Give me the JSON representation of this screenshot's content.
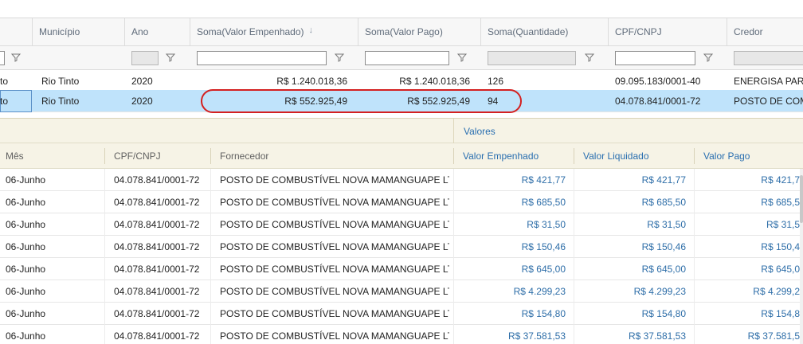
{
  "main_grid": {
    "columns": [
      {
        "label": "Município"
      },
      {
        "label": "Ano"
      },
      {
        "label": "Soma(Valor Empenhado)",
        "sort_icon": "arrow-down"
      },
      {
        "label": "Soma(Valor Pago)"
      },
      {
        "label": "Soma(Quantidade)"
      },
      {
        "label": "CPF/CNPJ"
      },
      {
        "label": "Credor"
      }
    ],
    "rows": [
      {
        "first": "to",
        "municipio": "Rio Tinto",
        "ano": "2020",
        "empenhado": "R$ 1.240.018,36",
        "pago": "R$ 1.240.018,36",
        "quantidade": "126",
        "cpf": "09.095.183/0001-40",
        "credor": "ENERGISA PARAÍBA"
      },
      {
        "first": "to",
        "municipio": "Rio Tinto",
        "ano": "2020",
        "empenhado": "R$ 552.925,49",
        "pago": "R$ 552.925,49",
        "quantidade": "94",
        "cpf": "04.078.841/0001-72",
        "credor": "POSTO DE COMBUSTÍVEL",
        "selected": true
      }
    ]
  },
  "detail_grid": {
    "group_label": "Valores",
    "columns": {
      "mes": "Mês",
      "cpf": "CPF/CNPJ",
      "fornecedor": "Fornecedor",
      "empenhado": "Valor Empenhado",
      "liquidado": "Valor Liquidado",
      "pago": "Valor Pago"
    },
    "rows": [
      {
        "mes": "06-Junho",
        "cpf": "04.078.841/0001-72",
        "fornecedor": "POSTO DE COMBUSTÍVEL NOVA MAMANGUAPE LT...",
        "empenhado": "R$ 421,77",
        "liquidado": "R$ 421,77",
        "pago": "R$ 421,7"
      },
      {
        "mes": "06-Junho",
        "cpf": "04.078.841/0001-72",
        "fornecedor": "POSTO DE COMBUSTÍVEL NOVA MAMANGUAPE LT...",
        "empenhado": "R$ 685,50",
        "liquidado": "R$ 685,50",
        "pago": "R$ 685,5"
      },
      {
        "mes": "06-Junho",
        "cpf": "04.078.841/0001-72",
        "fornecedor": "POSTO DE COMBUSTÍVEL NOVA MAMANGUAPE LT...",
        "empenhado": "R$ 31,50",
        "liquidado": "R$ 31,50",
        "pago": "R$ 31,5"
      },
      {
        "mes": "06-Junho",
        "cpf": "04.078.841/0001-72",
        "fornecedor": "POSTO DE COMBUSTÍVEL NOVA MAMANGUAPE LT...",
        "empenhado": "R$ 150,46",
        "liquidado": "R$ 150,46",
        "pago": "R$ 150,4"
      },
      {
        "mes": "06-Junho",
        "cpf": "04.078.841/0001-72",
        "fornecedor": "POSTO DE COMBUSTÍVEL NOVA MAMANGUAPE LT...",
        "empenhado": "R$ 645,00",
        "liquidado": "R$ 645,00",
        "pago": "R$ 645,0"
      },
      {
        "mes": "06-Junho",
        "cpf": "04.078.841/0001-72",
        "fornecedor": "POSTO DE COMBUSTÍVEL NOVA MAMANGUAPE LT...",
        "empenhado": "R$ 4.299,23",
        "liquidado": "R$ 4.299,23",
        "pago": "R$ 4.299,2"
      },
      {
        "mes": "06-Junho",
        "cpf": "04.078.841/0001-72",
        "fornecedor": "POSTO DE COMBUSTÍVEL NOVA MAMANGUAPE LT...",
        "empenhado": "R$ 154,80",
        "liquidado": "R$ 154,80",
        "pago": "R$ 154,8"
      },
      {
        "mes": "06-Junho",
        "cpf": "04.078.841/0001-72",
        "fornecedor": "POSTO DE COMBUSTÍVEL NOVA MAMANGUAPE LT...",
        "empenhado": "R$ 37.581,53",
        "liquidado": "R$ 37.581,53",
        "pago": "R$ 37.581,5"
      }
    ]
  },
  "colors": {
    "selected_row": "#bfe3fb",
    "detail_header_bg": "#f6f3e6",
    "accent_blue": "#2a6fb0",
    "highlight_red": "#d42020"
  }
}
